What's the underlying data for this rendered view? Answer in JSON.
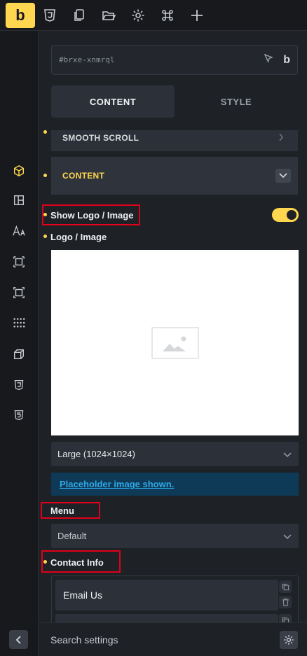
{
  "app": {
    "logo_letter": "b",
    "accent": "#ffd64f"
  },
  "toolbar": {
    "icons": [
      "css3-icon",
      "copy-pages-icon",
      "folder-open-icon",
      "settings-gear-icon",
      "command-icon",
      "plus-icon"
    ]
  },
  "rail": {
    "icons": [
      "cube-icon",
      "layout-icon",
      "typography-icon",
      "spacing-icon",
      "sizing-icon",
      "grid-dots-icon",
      "3d-box-icon",
      "css3-icon",
      "html5-icon"
    ]
  },
  "panel": {
    "element_id": "#brxe-xnmrql",
    "tabs": [
      {
        "label": "CONTENT",
        "active": true
      },
      {
        "label": "STYLE",
        "active": false
      }
    ],
    "sections": {
      "smooth_scroll": "SMOOTH SCROLL",
      "content": "CONTENT"
    },
    "show_logo_label": "Show Logo / Image",
    "show_logo_enabled": true,
    "logo_label": "Logo / Image",
    "image_size": "Large (1024×1024)",
    "placeholder_notice": "Placeholder image shown.",
    "menu_label": "Menu",
    "menu_value": "Default",
    "contact_label": "Contact Info",
    "contact_items": [
      "Email Us",
      ""
    ]
  },
  "bottom": {
    "search_label": "Search settings"
  }
}
